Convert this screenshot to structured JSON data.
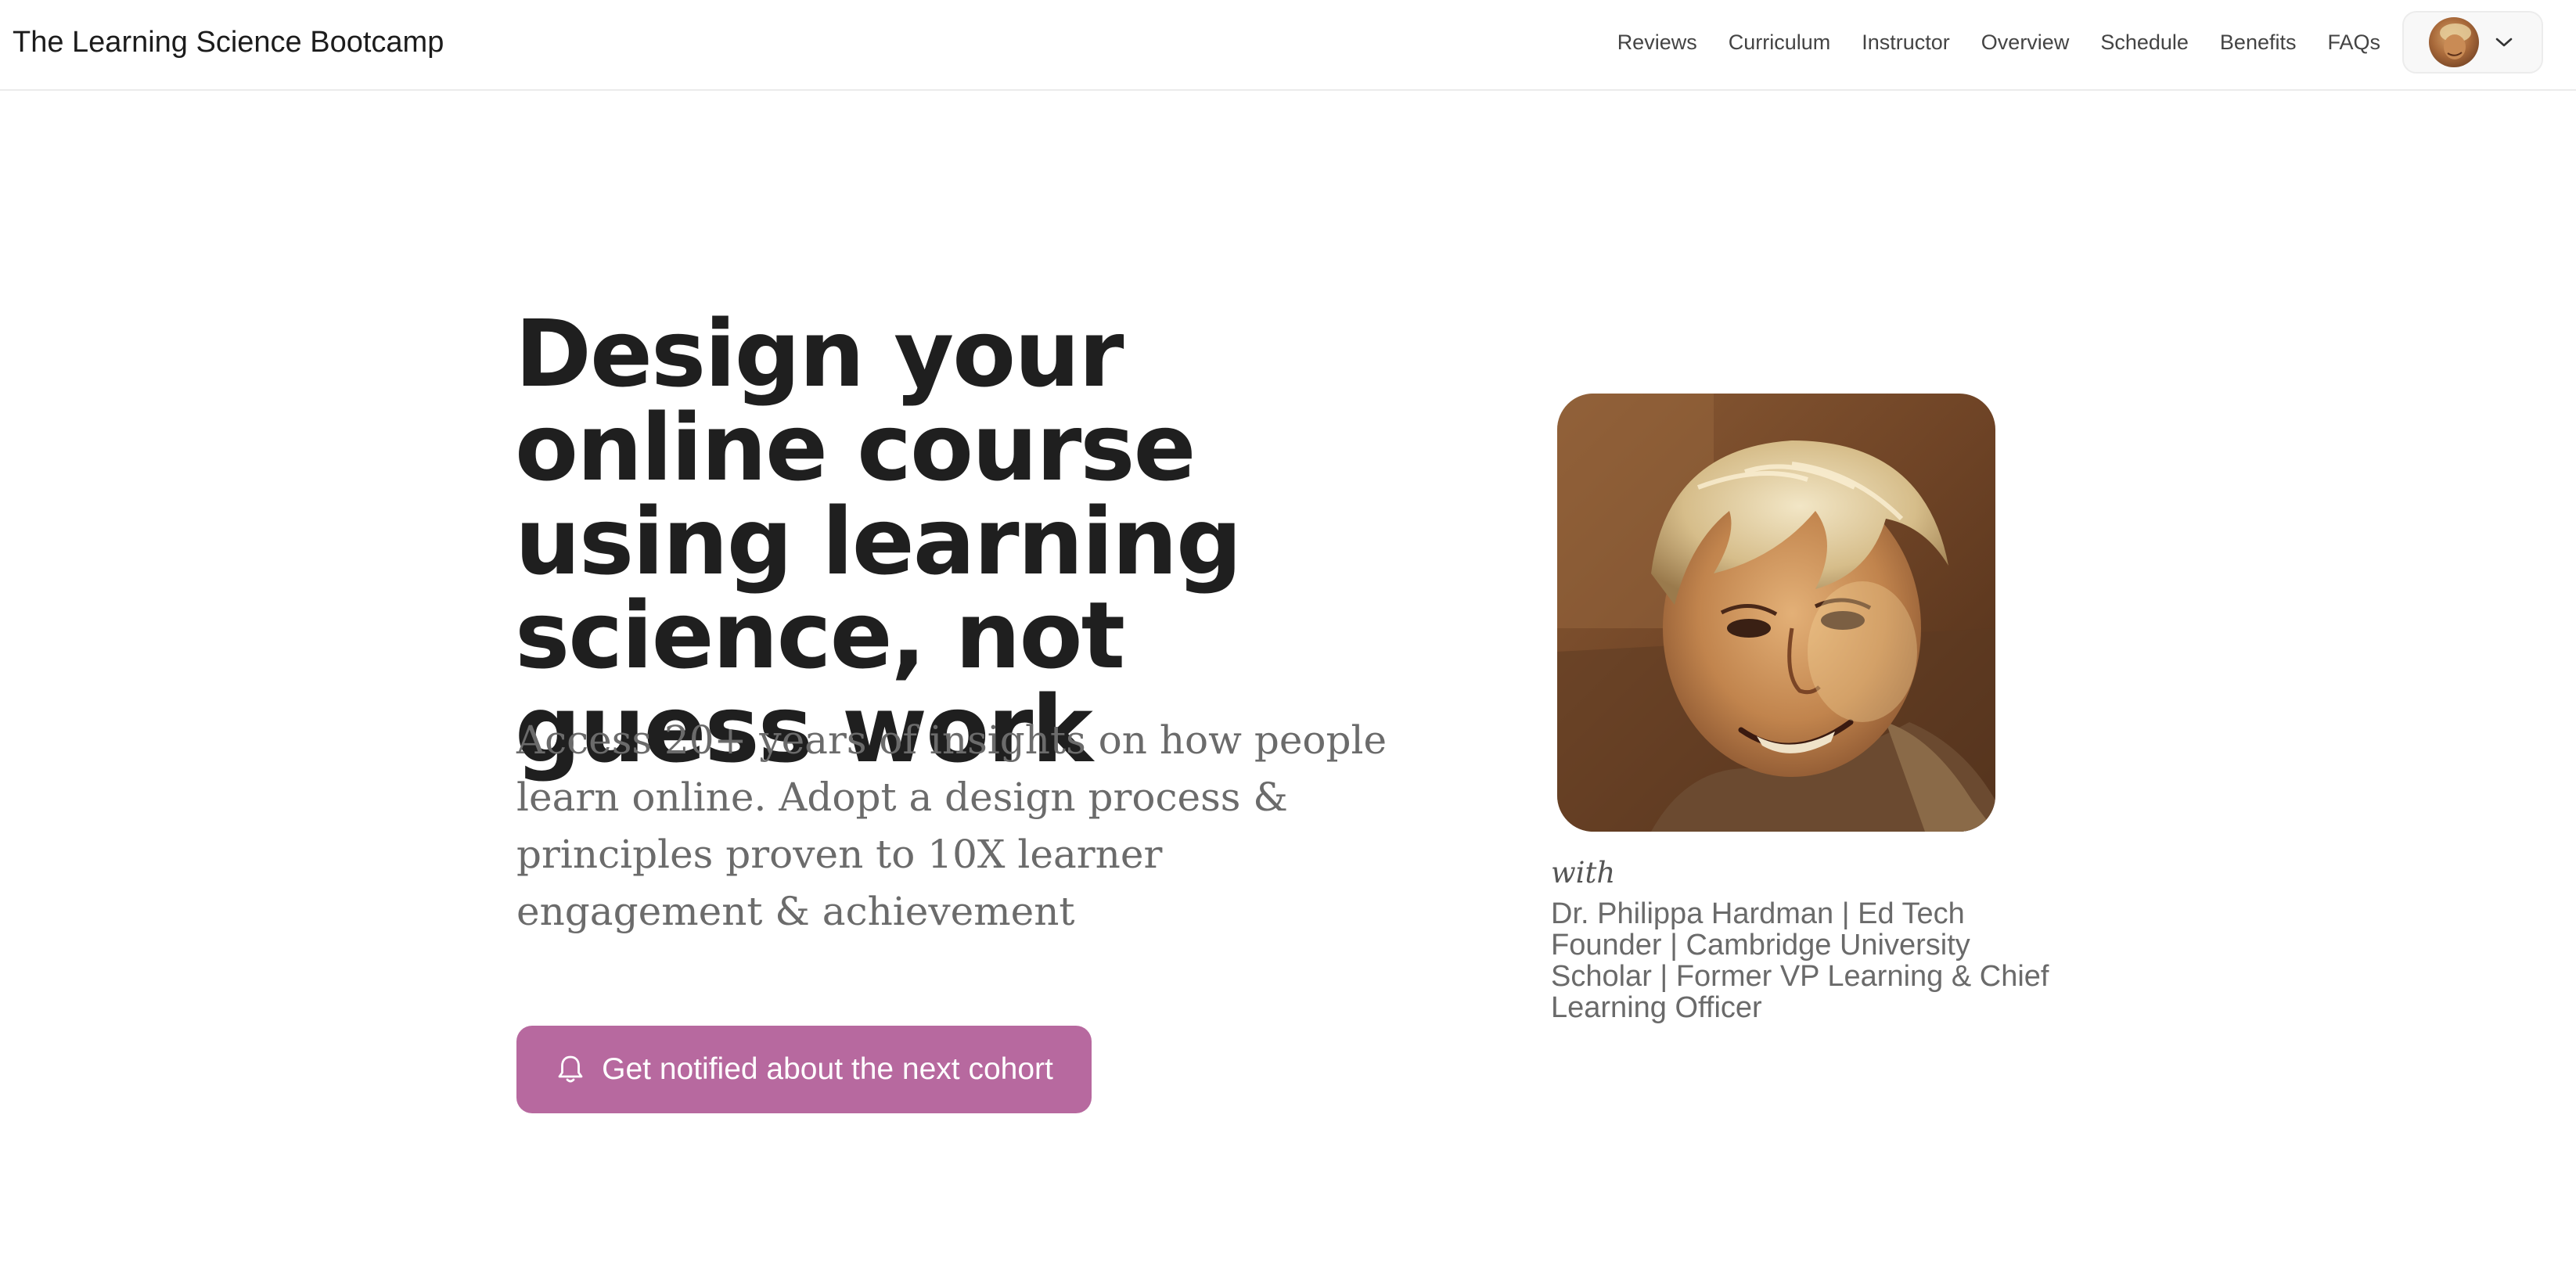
{
  "header": {
    "site_title": "The Learning Science Bootcamp",
    "nav": [
      {
        "label": "Reviews"
      },
      {
        "label": "Curriculum"
      },
      {
        "label": "Instructor"
      },
      {
        "label": "Overview"
      },
      {
        "label": "Schedule"
      },
      {
        "label": "Benefits"
      },
      {
        "label": "FAQs"
      }
    ],
    "account": {
      "avatar_icon": "user-avatar",
      "menu_icon": "chevron-down-icon"
    }
  },
  "hero": {
    "title": "Design your online course using learning science, not guess work",
    "subtitle": "Access 20+ years of insights on how people learn online. Adopt a design process & principles proven to 10X learner engagement & achievement",
    "cta": {
      "label": "Get notified about the next cohort",
      "icon": "bell-icon"
    }
  },
  "instructor": {
    "with_label": "with",
    "name": "Dr. Philippa Hardman | Ed Tech Founder | Cambridge University Scholar | Former VP Learning & Chief Learning Officer"
  },
  "colors": {
    "accent": "#b7699f",
    "title_text": "#1f1f1f",
    "subtitle_text": "#6b6b6b",
    "nav_text": "#444444"
  }
}
